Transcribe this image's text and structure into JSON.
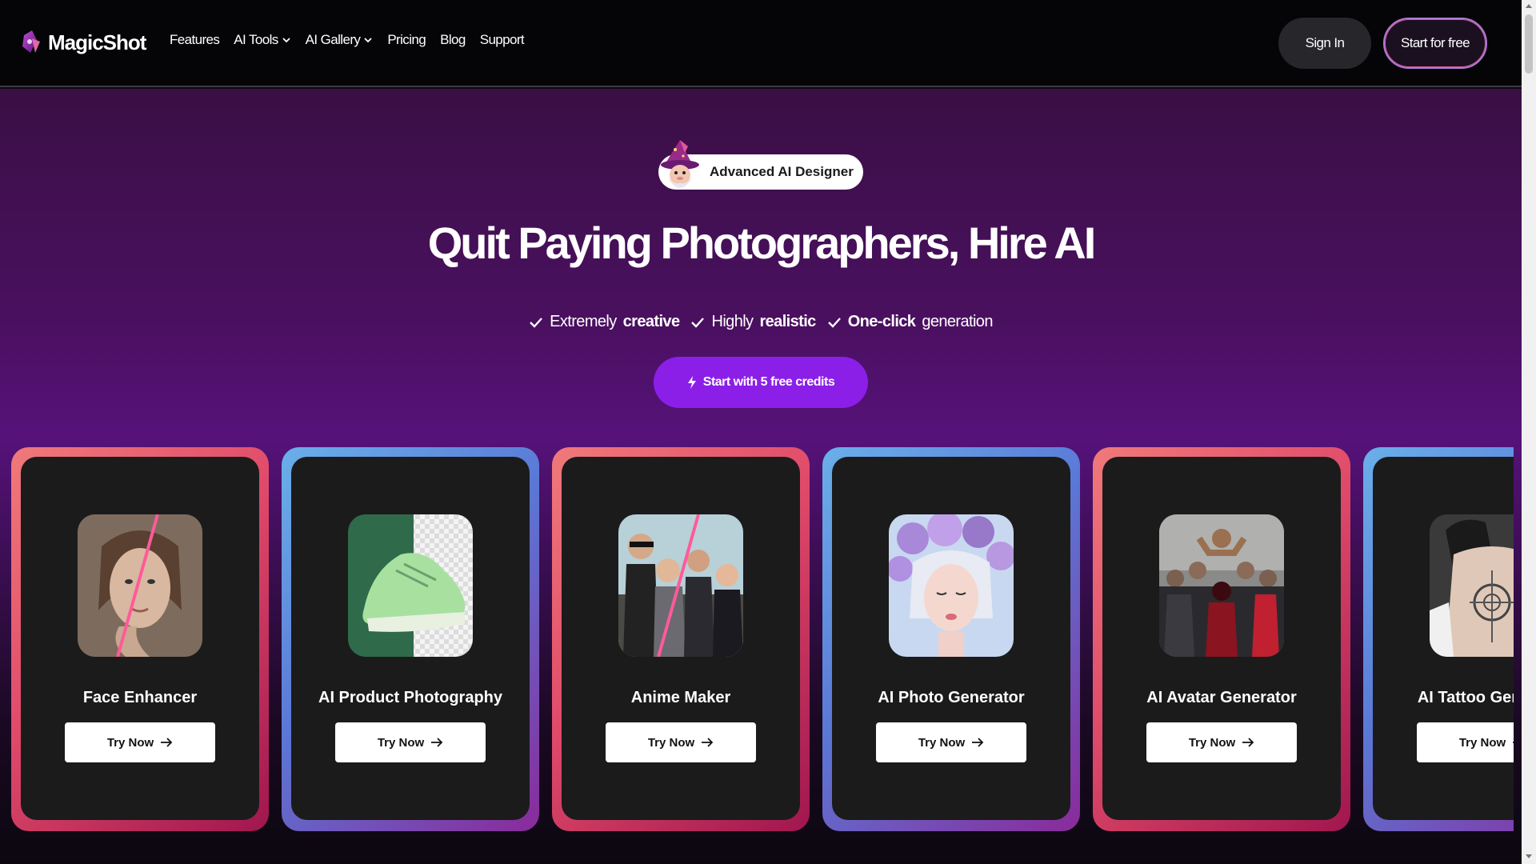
{
  "brand": {
    "name": "MagicShot"
  },
  "nav": {
    "items": [
      {
        "label": "Features",
        "has_dropdown": false
      },
      {
        "label": "AI Tools",
        "has_dropdown": true
      },
      {
        "label": "AI Gallery",
        "has_dropdown": true
      },
      {
        "label": "Pricing",
        "has_dropdown": false
      },
      {
        "label": "Blog",
        "has_dropdown": false
      },
      {
        "label": "Support",
        "has_dropdown": false
      }
    ],
    "sign_in": "Sign In",
    "start_free": "Start for free"
  },
  "hero": {
    "badge": "Advanced AI Designer",
    "headline": "Quit Paying Photographers, Hire AI",
    "features": [
      {
        "prefix": "Extremely",
        "bold": "creative",
        "suffix": ""
      },
      {
        "prefix": "Highly",
        "bold": "realistic",
        "suffix": ""
      },
      {
        "prefix": "",
        "bold": "One-click",
        "suffix": "generation"
      }
    ],
    "cta": "Start with 5 free credits"
  },
  "cards": [
    {
      "title": "Face Enhancer",
      "button": "Try Now",
      "style": "warm",
      "icon": "face-portrait-image"
    },
    {
      "title": "AI Product Photography",
      "button": "Try Now",
      "style": "cool",
      "icon": "sneaker-product-image"
    },
    {
      "title": "Anime Maker",
      "button": "Try Now",
      "style": "warm",
      "icon": "group-photo-image"
    },
    {
      "title": "AI Photo Generator",
      "button": "Try Now",
      "style": "cool",
      "icon": "flower-portrait-image"
    },
    {
      "title": "AI Avatar Generator",
      "button": "Try Now",
      "style": "warm",
      "icon": "heroes-group-image"
    },
    {
      "title": "AI Tattoo Generator",
      "button": "Try Now",
      "style": "cool",
      "icon": "tattoo-back-image"
    }
  ],
  "colors": {
    "accent": "#8b1fe8",
    "header_bg": "#050508",
    "card_bg": "#1b1b1c"
  }
}
